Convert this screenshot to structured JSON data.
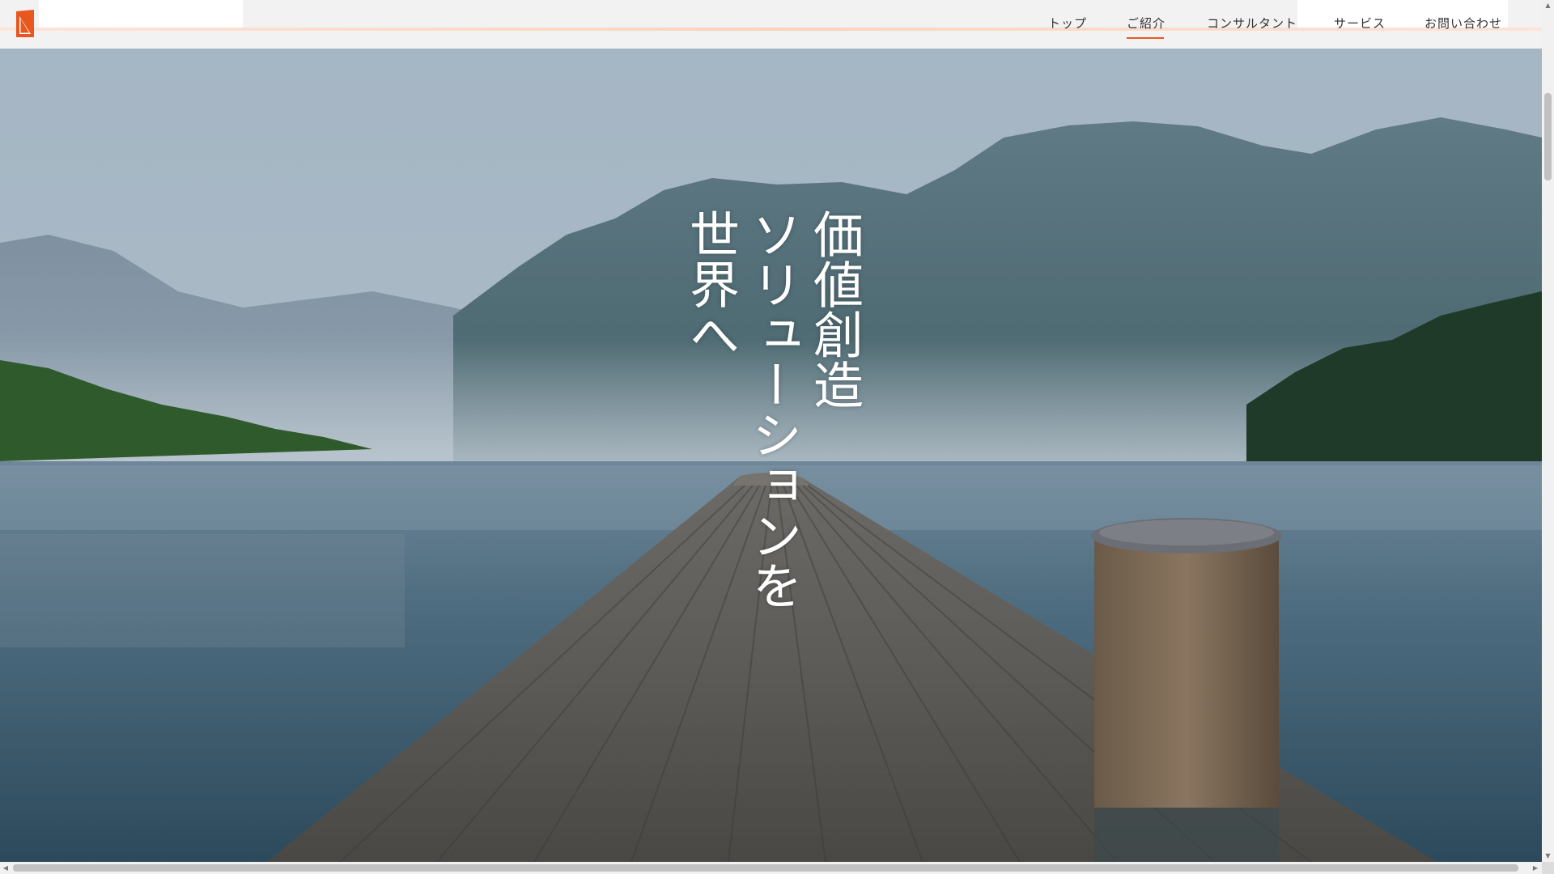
{
  "nav": {
    "items": [
      {
        "label": "トップ",
        "active": false
      },
      {
        "label": "ご紹介",
        "active": true
      },
      {
        "label": "コンサルタント",
        "active": false
      },
      {
        "label": "サービス",
        "active": false
      },
      {
        "label": "お問い合わせ",
        "active": false
      }
    ]
  },
  "hero": {
    "tagline_lines": [
      "価値創造",
      "ソリューションを",
      "世界へ"
    ],
    "background": "lake-pier-mountain-photo"
  },
  "logo": {
    "icon": "brand-logo-icon"
  },
  "colors": {
    "accent": "#e8571e",
    "header_bg": "#f2f2f2",
    "nav_text": "#333333",
    "tagline_text": "#ffffff"
  },
  "scrollbars": {
    "vertical": true,
    "horizontal": true,
    "arrows": {
      "up": "▲",
      "down": "▼",
      "left": "◀",
      "right": "▶"
    }
  }
}
